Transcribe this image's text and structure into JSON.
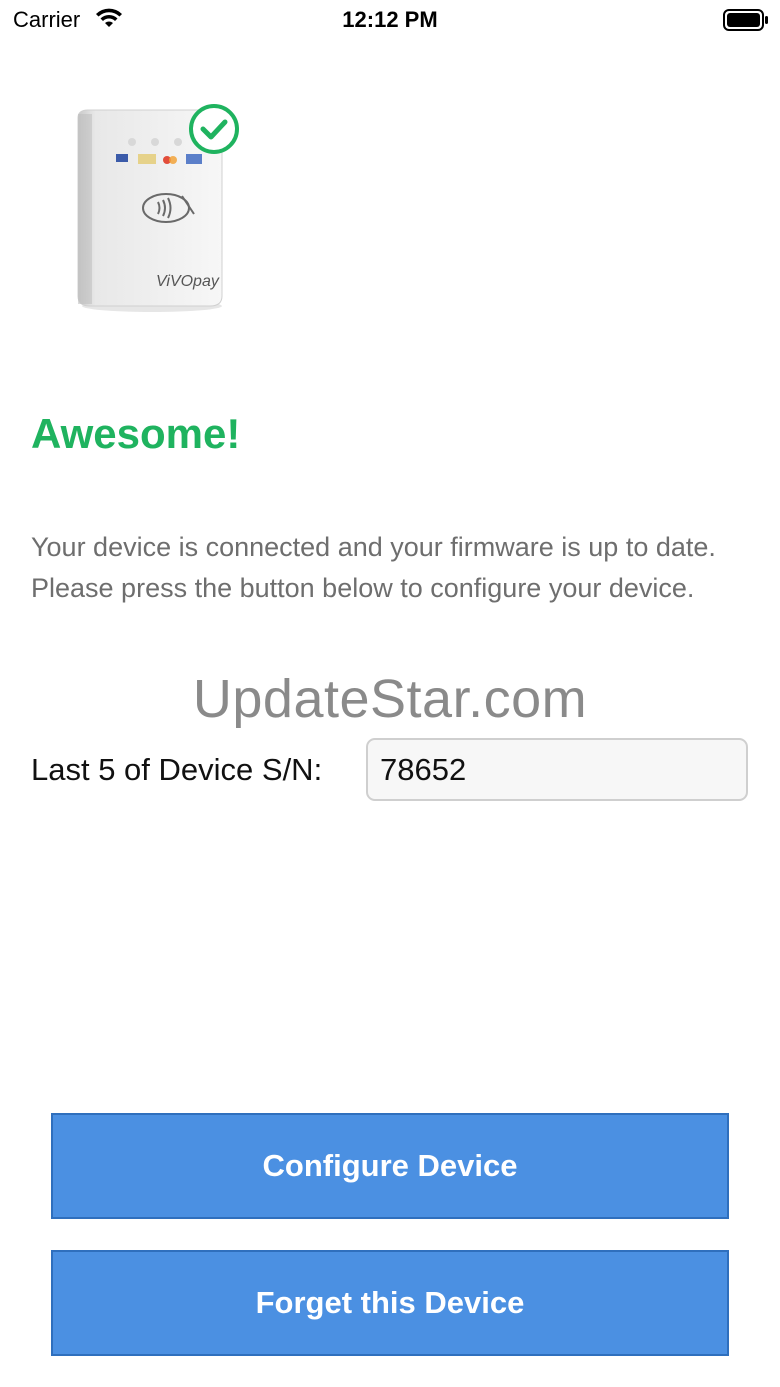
{
  "status_bar": {
    "carrier": "Carrier",
    "time": "12:12 PM"
  },
  "device": {
    "brand_text": "ViVOpay",
    "check_icon": "check-circle-icon",
    "accent_color": "#1fb35f"
  },
  "content": {
    "headline": "Awesome!",
    "message": "Your device is connected and your firmware is up to date. Please press the button below to configure your device.",
    "watermark": "UpdateStar.com"
  },
  "serial": {
    "label": "Last 5 of Device S/N:",
    "value": "78652"
  },
  "buttons": {
    "configure_label": "Configure Device",
    "forget_label": "Forget this Device",
    "color": "#4b90e2"
  }
}
